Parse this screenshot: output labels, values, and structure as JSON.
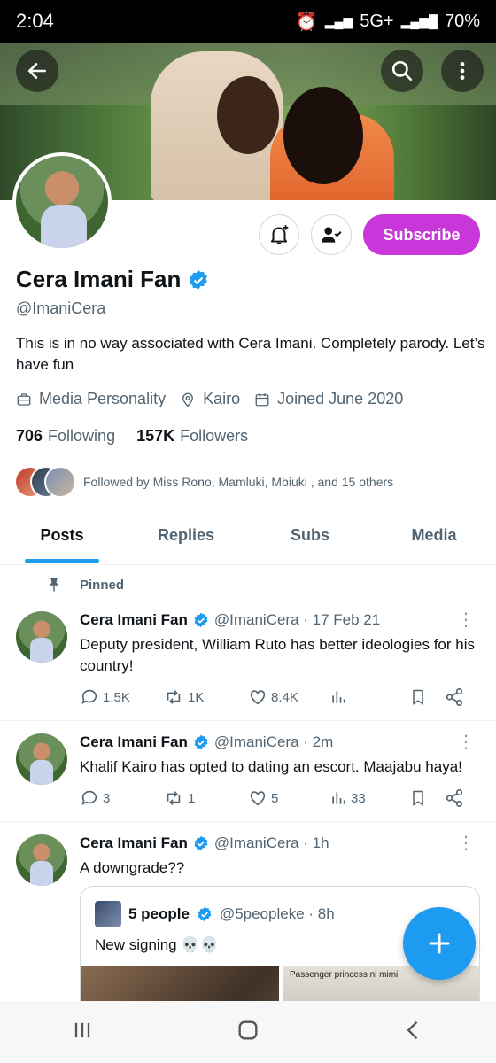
{
  "status_bar": {
    "time": "2:04",
    "network": "5G+",
    "battery": "70%"
  },
  "profile": {
    "name": "Cera Imani Fan",
    "handle": "@ImaniCera",
    "bio": "This is in no way associated with Cera Imani. Completely parody. Let’s have fun",
    "category": "Media Personality",
    "location": "Kairo",
    "joined": "Joined June 2020",
    "following_count": "706",
    "following_label": "Following",
    "followers_count": "157K",
    "followers_label": "Followers",
    "followed_by": "Followed by Miss Rono, Mamluki, Mbiuki , and 15 others",
    "subscribe_label": "Subscribe"
  },
  "tabs": [
    {
      "label": "Posts",
      "active": true
    },
    {
      "label": "Replies",
      "active": false
    },
    {
      "label": "Subs",
      "active": false
    },
    {
      "label": "Media",
      "active": false
    }
  ],
  "pinned_label": "Pinned",
  "tweets": [
    {
      "name": "Cera Imani Fan",
      "handle_time": "@ImaniCera · 17 Feb 21",
      "text": "Deputy president, William Ruto has better ideologies for his country!",
      "replies": "1.5K",
      "retweets": "1K",
      "likes": "8.4K",
      "views": ""
    },
    {
      "name": "Cera Imani Fan",
      "handle_time": "@ImaniCera · 2m",
      "text": "Khalif Kairo has opted to dating an escort. Maajabu haya!",
      "replies": "3",
      "retweets": "1",
      "likes": "5",
      "views": "33"
    },
    {
      "name": "Cera Imani Fan",
      "handle_time": "@ImaniCera · 1h",
      "text": "A downgrade??"
    }
  ],
  "quote": {
    "name": "5 people",
    "handle_time": "@5peopleke · 8h",
    "text": "New signing 💀💀",
    "image_caption": "Passenger princess ni mimi"
  },
  "colors": {
    "accent": "#1d9bf0",
    "subscribe": "#c936d9",
    "verified": "#1d9bf0"
  }
}
